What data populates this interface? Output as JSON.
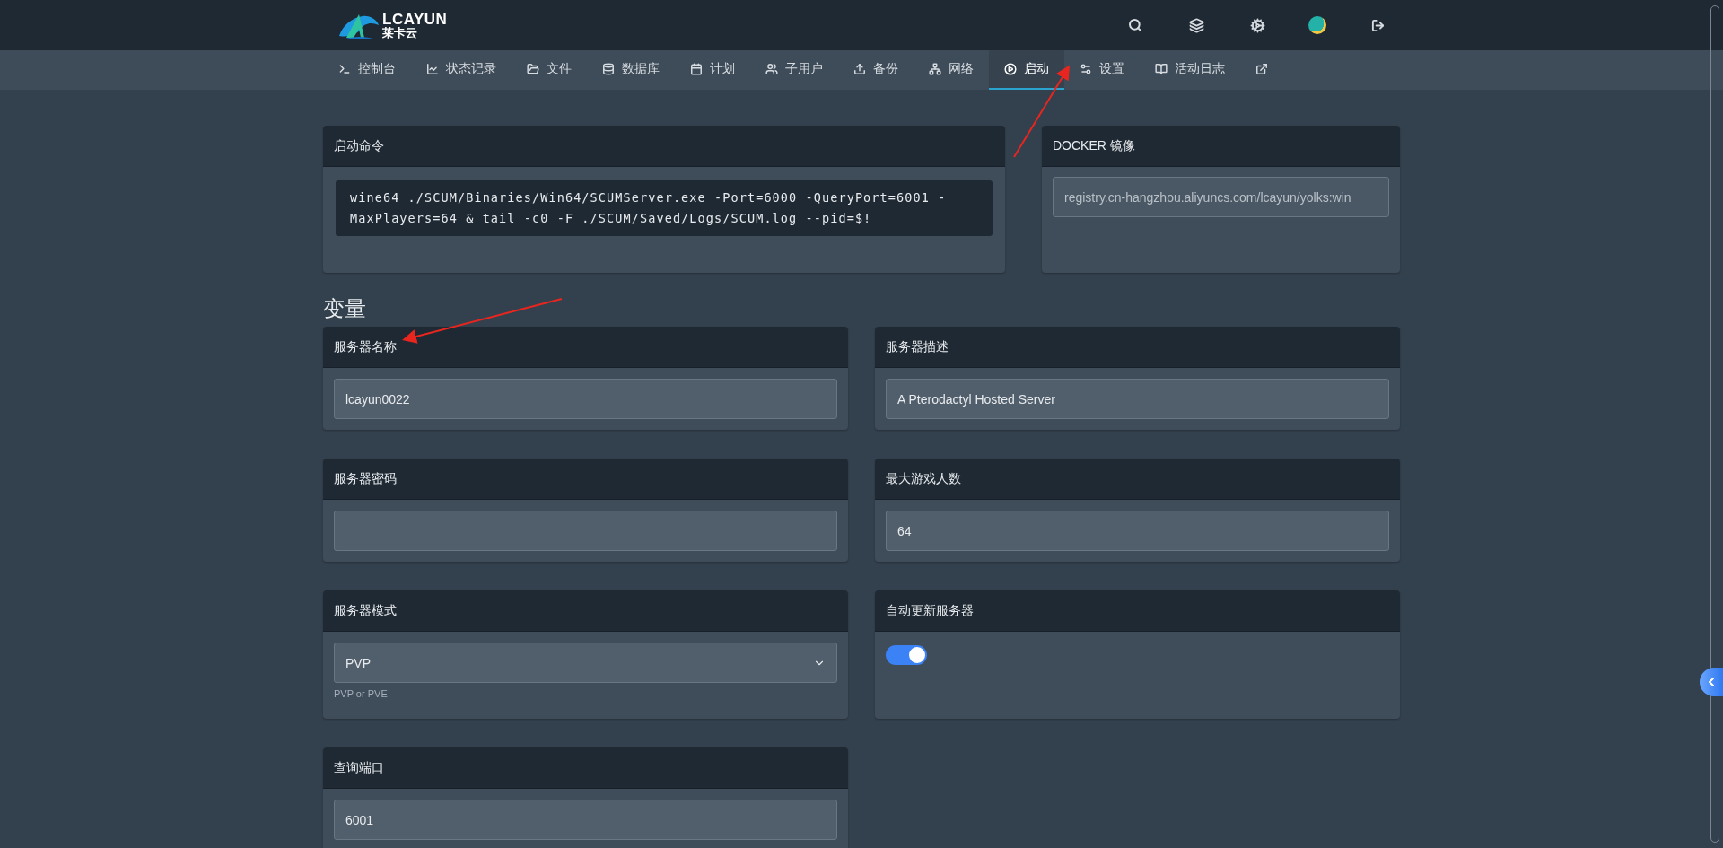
{
  "logo": {
    "wordmark": "LCAYUN",
    "subtitle": "莱卡云"
  },
  "tabs": [
    {
      "label": "控制台",
      "selected": false
    },
    {
      "label": "状态记录",
      "selected": false
    },
    {
      "label": "文件",
      "selected": false
    },
    {
      "label": "数据库",
      "selected": false
    },
    {
      "label": "计划",
      "selected": false
    },
    {
      "label": "子用户",
      "selected": false
    },
    {
      "label": "备份",
      "selected": false
    },
    {
      "label": "网络",
      "selected": false
    },
    {
      "label": "启动",
      "selected": true
    },
    {
      "label": "设置",
      "selected": false
    },
    {
      "label": "活动日志",
      "selected": false
    },
    {
      "selected": false
    }
  ],
  "startup": {
    "title": "启动命令",
    "command": "wine64 ./SCUM/Binaries/Win64/SCUMServer.exe -Port=6000 -QueryPort=6001 -MaxPlayers=64 & tail -c0 -F ./SCUM/Saved/Logs/SCUM.log --pid=$!"
  },
  "docker": {
    "title": "DOCKER 镜像",
    "value": "registry.cn-hangzhou.aliyuncs.com/lcayun/yolks:win"
  },
  "variables_heading": "变量",
  "variables": [
    {
      "kind": "text",
      "label": "服务器名称",
      "value": "lcayun0022"
    },
    {
      "kind": "text",
      "label": "服务器描述",
      "value": "A Pterodactyl Hosted Server"
    },
    {
      "kind": "text",
      "label": "服务器密码"
    },
    {
      "kind": "text",
      "label": "最大游戏人数",
      "value": "64"
    },
    {
      "kind": "select",
      "label": "服务器模式",
      "value": "PVP",
      "help": "PVP or PVE"
    },
    {
      "kind": "toggle",
      "label": "自动更新服务器",
      "on": true
    },
    {
      "kind": "text",
      "label": "查询端口",
      "value": "6001"
    }
  ]
}
